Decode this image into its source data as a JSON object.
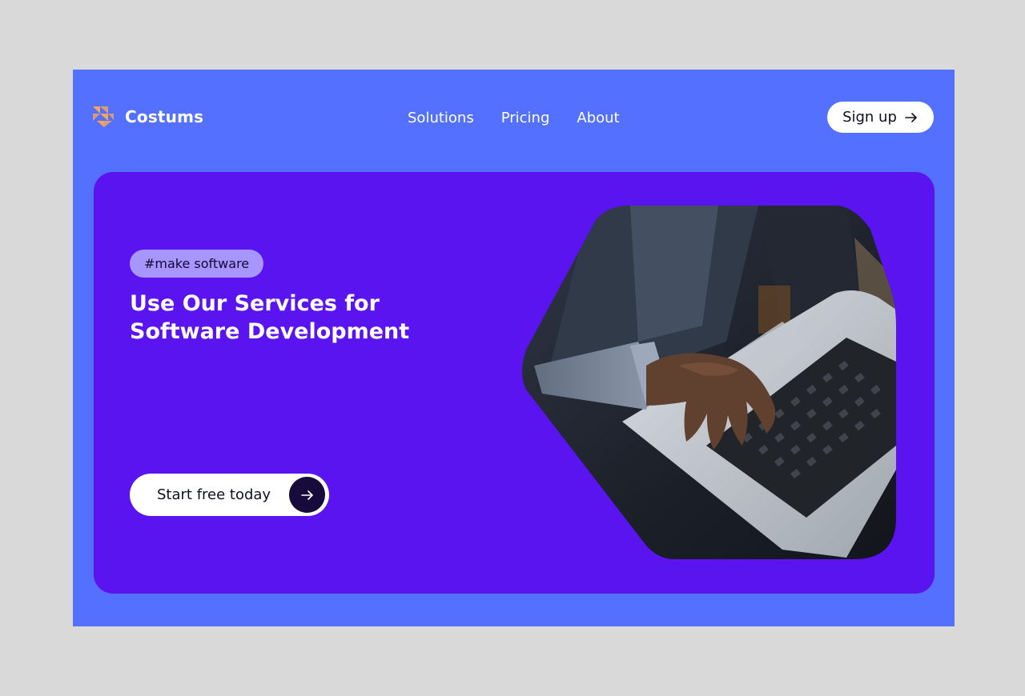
{
  "header": {
    "brand": "Costums",
    "nav": [
      "Solutions",
      "Pricing",
      "About"
    ],
    "signup_label": "Sign up"
  },
  "hero": {
    "tag": "#make software",
    "headline_line1": "Use Our Services for",
    "headline_line2": "Software Development",
    "cta_label": "Start free today"
  },
  "colors": {
    "page_background": "#d9d9d9",
    "frame": "#5470fe",
    "hero": "#5a14f0",
    "tag": "#a796fd",
    "logo_accent": "#f6a45b",
    "cta_circle": "#170b3b"
  },
  "icons": {
    "logo": "triangles-logo-icon",
    "signup": "arrow-right-icon",
    "cta": "arrow-right-icon"
  },
  "image": {
    "subject": "hands typing on a laptop keyboard"
  }
}
